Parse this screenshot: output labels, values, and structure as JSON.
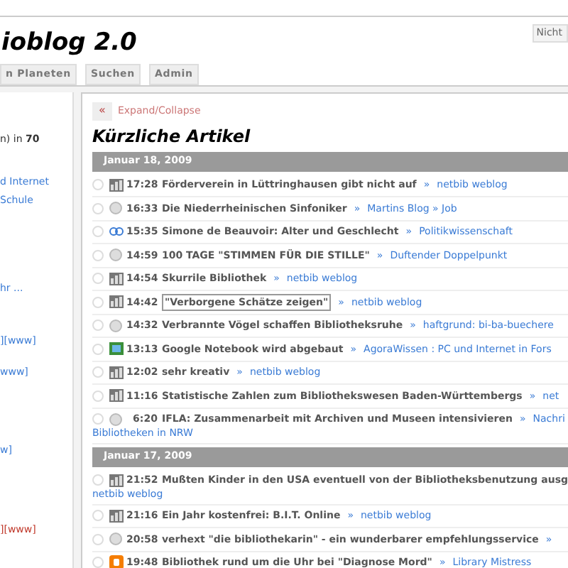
{
  "header": {
    "title": "ioblog 2.0",
    "nav": [
      {
        "label": "n Planeten"
      },
      {
        "label": "Suchen"
      },
      {
        "label": "Admin"
      }
    ],
    "corner_button": "Nicht"
  },
  "sidebar": {
    "lines": [
      {
        "text": "n) in **70**",
        "kind": "text"
      },
      {
        "text": "d Internet",
        "kind": "link"
      },
      {
        "text": "Schule",
        "kind": "link"
      },
      {
        "text": "hr ...",
        "kind": "link"
      },
      {
        "text": "][www]",
        "kind": "link"
      },
      {
        "text": "www]",
        "kind": "link"
      },
      {
        "text": "w]",
        "kind": "link"
      },
      {
        "text": "][www]",
        "kind": "alert"
      }
    ]
  },
  "main": {
    "toggle_icon": "«",
    "toggle_label": "Expand/Collapse",
    "heading": "Kürzliche Artikel",
    "days": [
      {
        "date": "Januar 18, 2009",
        "items": [
          {
            "kind": "feed",
            "time": "17:28",
            "title": "Förderverein in Lüttringhausen gibt nicht auf",
            "sep": "»",
            "source": "netbib weblog",
            "outlined": false
          },
          {
            "kind": "dot",
            "time": "16:33",
            "title": "Die Niederrheinischen Sinfoniker",
            "sep": "»",
            "source": "Martins Blog » Job",
            "outlined": false
          },
          {
            "kind": "link",
            "time": "15:35",
            "title": "Simone de Beauvoir: Alter und Geschlecht",
            "sep": "»",
            "source": "Politikwissenschaft",
            "outlined": false
          },
          {
            "kind": "dot",
            "time": "14:59",
            "title": "100 TAGE \"STIMMEN FÜR DIE STILLE\"",
            "sep": "»",
            "source": "Duftender Doppelpunkt",
            "outlined": false
          },
          {
            "kind": "feed",
            "time": "14:54",
            "title": "Skurrile Bibliothek",
            "sep": "»",
            "source": "netbib weblog",
            "outlined": false
          },
          {
            "kind": "feed",
            "time": "14:42",
            "title": "\"Verborgene Schätze zeigen\"",
            "sep": "»",
            "source": "netbib weblog",
            "outlined": true
          },
          {
            "kind": "dot",
            "time": "14:32",
            "title": "Verbrannte Vögel schaffen Bibliotheksruhe",
            "sep": "»",
            "source": "haftgrund: bi-ba-buechere",
            "outlined": false
          },
          {
            "kind": "green",
            "time": "13:13",
            "title": "Google Notebook wird abgebaut",
            "sep": "»",
            "source": "AgoraWissen : PC und Internet in Fors",
            "outlined": false
          },
          {
            "kind": "feed",
            "time": "12:02",
            "title": "sehr kreativ",
            "sep": "»",
            "source": "netbib weblog",
            "outlined": false
          },
          {
            "kind": "feed",
            "time": "11:16",
            "title": "Statistische Zahlen zum Bibliothekswesen Baden-Württembergs",
            "sep": "»",
            "source": "net",
            "outlined": false
          },
          {
            "kind": "dot",
            "time": "6:20",
            "title": "IFLA: Zusammenarbeit mit Archiven und Museen intensivieren",
            "sep": "»",
            "source": "Nachri",
            "continuation": "Bibliotheken in NRW",
            "outlined": false
          }
        ]
      },
      {
        "date": "Januar 17, 2009",
        "items": [
          {
            "kind": "feed",
            "time": "21:52",
            "title": "Mußten Kinder in den USA eventuell von der Bibliotheksbenutzung ausg",
            "continuation": "netbib weblog",
            "outlined": false
          },
          {
            "kind": "feed",
            "time": "21:16",
            "title": "Ein Jahr kostenfrei: B.I.T. Online",
            "sep": "»",
            "source": "netbib weblog",
            "outlined": false
          },
          {
            "kind": "dot",
            "time": "20:58",
            "title": "verhext \"die bibliothekarin\" - ein wunderbarer empfehlungsservice",
            "sep": "»",
            "outlined": false
          },
          {
            "kind": "blogger",
            "time": "19:48",
            "title": "Bibliothek rund um die Uhr bei \"Diagnose Mord\"",
            "sep": "»",
            "source": "Library Mistress",
            "outlined": false
          }
        ]
      }
    ]
  }
}
